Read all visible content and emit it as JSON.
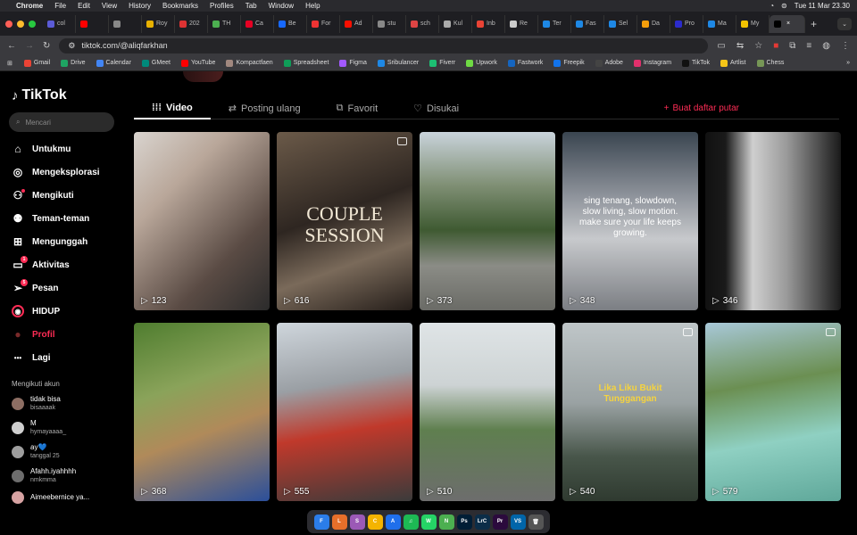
{
  "menubar": {
    "app": "Chrome",
    "items": [
      "File",
      "Edit",
      "View",
      "History",
      "Bookmarks",
      "Profiles",
      "Tab",
      "Window",
      "Help"
    ],
    "clock": "Tue 11 Mar  23.30"
  },
  "tabs": [
    {
      "label": "col",
      "color": "#5b5bd6"
    },
    {
      "label": "",
      "color": "#ff0000"
    },
    {
      "label": "",
      "color": "#888"
    },
    {
      "label": "Roy",
      "color": "#e8b100"
    },
    {
      "label": "202",
      "color": "#d33"
    },
    {
      "label": "TH",
      "color": "#4caf50"
    },
    {
      "label": "Ca",
      "color": "#e60023"
    },
    {
      "label": "Be",
      "color": "#1769ff"
    },
    {
      "label": "For",
      "color": "#e33"
    },
    {
      "label": "Ad",
      "color": "#fa0f00"
    },
    {
      "label": "stu",
      "color": "#888"
    },
    {
      "label": "sch",
      "color": "#d44"
    },
    {
      "label": "Kul",
      "color": "#aaa"
    },
    {
      "label": "Inb",
      "color": "#ea4335"
    },
    {
      "label": "Re",
      "color": "#ccc"
    },
    {
      "label": "Ter",
      "color": "#1e88e5"
    },
    {
      "label": "Fas",
      "color": "#1e88e5"
    },
    {
      "label": "Sel",
      "color": "#1e88e5"
    },
    {
      "label": "Da",
      "color": "#f59e0b"
    },
    {
      "label": "Pro",
      "color": "#2b2bcc"
    },
    {
      "label": "Ma",
      "color": "#1e88e5"
    },
    {
      "label": "My",
      "color": "#f2c200"
    },
    {
      "label": "",
      "color": "#000"
    }
  ],
  "address": {
    "url": "tiktok.com/@aliqfarkhan"
  },
  "bookmarks": [
    {
      "label": "Gmail",
      "color": "#ea4335"
    },
    {
      "label": "Drive",
      "color": "#1fa463"
    },
    {
      "label": "Calendar",
      "color": "#4285f4"
    },
    {
      "label": "GMeet",
      "color": "#00897b"
    },
    {
      "label": "YouTube",
      "color": "#ff0000"
    },
    {
      "label": "Kompactfaen",
      "color": "#a1887f"
    },
    {
      "label": "Spreadsheet",
      "color": "#0f9d58"
    },
    {
      "label": "Figma",
      "color": "#a259ff"
    },
    {
      "label": "Sribulancer",
      "color": "#1e88e5"
    },
    {
      "label": "Fiverr",
      "color": "#1dbf73"
    },
    {
      "label": "Upwork",
      "color": "#6fda44"
    },
    {
      "label": "Fastwork",
      "color": "#1565c0"
    },
    {
      "label": "Freepik",
      "color": "#1273eb"
    },
    {
      "label": "Adobe",
      "color": "#444"
    },
    {
      "label": "Instagram",
      "color": "#e1306c"
    },
    {
      "label": "TikTok",
      "color": "#111"
    },
    {
      "label": "Artlist",
      "color": "#f5c518"
    },
    {
      "label": "Chess",
      "color": "#769656"
    }
  ],
  "sidebar": {
    "logo": "TikTok",
    "search_placeholder": "Mencari",
    "nav": [
      {
        "label": "Untukmu",
        "icon": "home-icon",
        "glyph": "⌂",
        "active": false,
        "badge": ""
      },
      {
        "label": "Mengeksplorasi",
        "icon": "compass-icon",
        "glyph": "◎",
        "active": false,
        "badge": ""
      },
      {
        "label": "Mengikuti",
        "icon": "following-icon",
        "glyph": "⚇",
        "active": false,
        "badge": "dot"
      },
      {
        "label": "Teman-teman",
        "icon": "friends-icon",
        "glyph": "⚉",
        "active": false,
        "badge": ""
      },
      {
        "label": "Mengunggah",
        "icon": "upload-icon",
        "glyph": "⊞",
        "active": false,
        "badge": ""
      },
      {
        "label": "Aktivitas",
        "icon": "activity-icon",
        "glyph": "▭",
        "active": false,
        "badge": "1"
      },
      {
        "label": "Pesan",
        "icon": "send-icon",
        "glyph": "➢",
        "active": false,
        "badge": "5"
      },
      {
        "label": "HIDUP",
        "icon": "live-icon",
        "glyph": "◉",
        "active": false,
        "badge": ""
      },
      {
        "label": "Profil",
        "icon": "profile-icon",
        "glyph": "●",
        "active": true,
        "badge": ""
      },
      {
        "label": "Lagi",
        "icon": "more-icon",
        "glyph": "•••",
        "active": false,
        "badge": ""
      }
    ],
    "following_heading": "Mengikuti akun",
    "following": [
      {
        "name": "tidak bisa",
        "user": "bisaaaak",
        "color": "#8d6e63"
      },
      {
        "name": "M",
        "user": "hymayaaaa_",
        "color": "#cfcfcf"
      },
      {
        "name": "ay💙",
        "user": "tanggal 25",
        "color": "#9e9e9e"
      },
      {
        "name": "Afahh.iyahhhh",
        "user": "nmkmma",
        "color": "#6d6d6d"
      },
      {
        "name": "Aimeebernice ya...",
        "user": "",
        "color": "#d7a3a3"
      }
    ]
  },
  "profile": {
    "tabs": [
      {
        "label": "Video",
        "icon": "grid-icon",
        "glyph": "⁞⁞⁞",
        "active": true
      },
      {
        "label": "Posting ulang",
        "icon": "repost-icon",
        "glyph": "⇄",
        "active": false
      },
      {
        "label": "Favorit",
        "icon": "bookmark-icon",
        "glyph": "⧉",
        "active": false
      },
      {
        "label": "Disukai",
        "icon": "heart-icon",
        "glyph": "♡",
        "active": false
      }
    ],
    "playlist_label": "Buat daftar putar"
  },
  "videos": [
    {
      "views": "123",
      "bg": "linear-gradient(135deg,#d9d4cf 0%,#b9a79a 30%,#5a4b44 70%,#2b2b2b 100%)",
      "caption": "",
      "photo": false
    },
    {
      "views": "616",
      "bg": "linear-gradient(160deg,#6b5a49 0%,#2e2621 45%,#7a6a5a 70%,#251e1a 100%)",
      "caption": "COUPLE SESSION",
      "photo": true
    },
    {
      "views": "373",
      "bg": "linear-gradient(180deg,#c9d3db 0%,#7f8f74 30%,#3f5a32 55%,#8b8c86 75%,#6a6b66 100%)",
      "caption": "",
      "photo": false
    },
    {
      "views": "348",
      "bg": "linear-gradient(180deg,#3a4550 0%,#8c9199 35%,#c7c9cc 60%,#7b7e83 100%)",
      "caption": "sing tenang, slowdown, slow living, slow motion. make sure your life keeps growing.",
      "photo": false
    },
    {
      "views": "346",
      "bg": "linear-gradient(90deg,#111 0%,#1a1a1a 15%,#cfcfcf 35%,#9a9a9a 60%,#1a1a1a 100%)",
      "caption": "",
      "photo": false
    },
    {
      "views": "368",
      "bg": "linear-gradient(160deg,#4f7d2f 0%,#8aa35a 35%,#b08a5a 60%,#2b4f9a 100%)",
      "caption": "",
      "photo": false
    },
    {
      "views": "555",
      "bg": "linear-gradient(170deg,#cfd6dc 0%,#9a9fa4 35%,#c0392b 60%,#3b3b3b 100%)",
      "caption": "",
      "photo": false
    },
    {
      "views": "510",
      "bg": "linear-gradient(180deg,#dfe4e6 0%,#cdd3d4 35%,#5f7f4f 60%,#6d6d6d 100%)",
      "caption": "",
      "photo": false
    },
    {
      "views": "540",
      "bg": "linear-gradient(180deg,#bfc6c8 0%,#9aa2a3 45%,#48564a 75%,#2f3a30 100%)",
      "caption": "Lika Liku Bukit Tunggangan",
      "photo": true
    },
    {
      "views": "579",
      "bg": "linear-gradient(170deg,#a8c8d8 0%,#6b8f52 35%,#8fd0c2 65%,#5fa89a 100%)",
      "caption": "",
      "photo": true
    }
  ],
  "dock": [
    {
      "label": "F",
      "color": "#2b7de9"
    },
    {
      "label": "L",
      "color": "#e66f2a"
    },
    {
      "label": "S",
      "color": "#9b59b6"
    },
    {
      "label": "C",
      "color": "#f4b400"
    },
    {
      "label": "A",
      "color": "#1f6feb"
    },
    {
      "label": "♫",
      "color": "#1db954"
    },
    {
      "label": "W",
      "color": "#25d366"
    },
    {
      "label": "N",
      "color": "#4caf50"
    },
    {
      "label": "Ps",
      "color": "#001e36"
    },
    {
      "label": "LrC",
      "color": "#0b2d48"
    },
    {
      "label": "Pr",
      "color": "#2b0a3d"
    },
    {
      "label": "VS",
      "color": "#0065a9"
    },
    {
      "label": "🗑",
      "color": "#555"
    }
  ]
}
